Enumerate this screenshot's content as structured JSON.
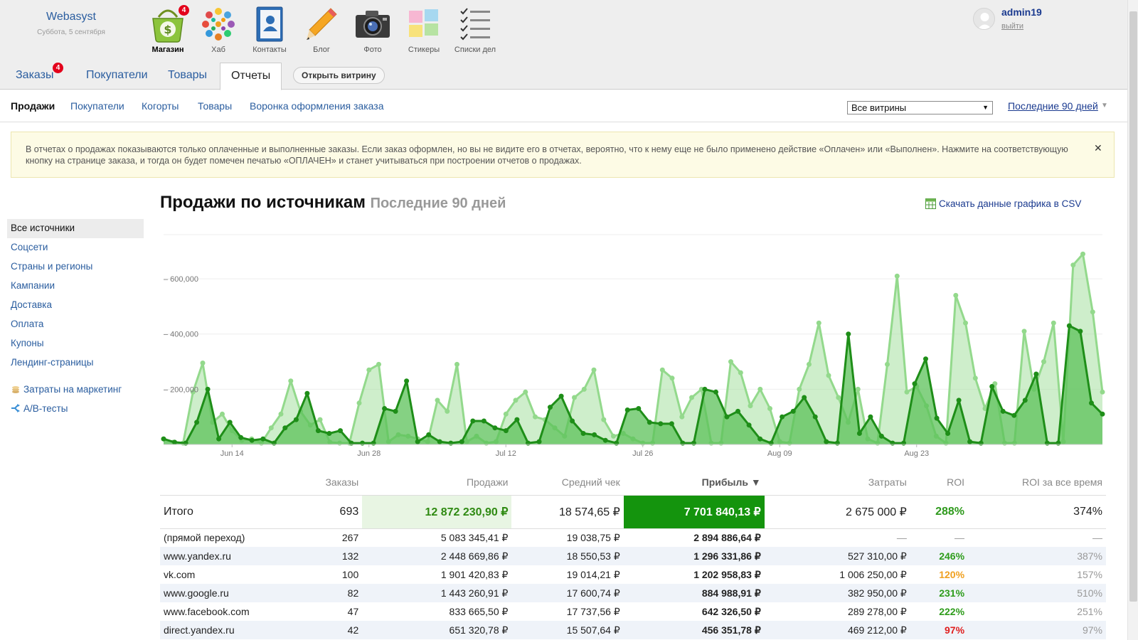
{
  "brand": {
    "name": "Webasyst",
    "date": "Суббота, 5 сентября"
  },
  "apps": [
    {
      "label": "Магазин",
      "icon": "shop-basket-icon",
      "badge": "4",
      "active": true
    },
    {
      "label": "Хаб",
      "icon": "hub-icon"
    },
    {
      "label": "Контакты",
      "icon": "contacts-icon"
    },
    {
      "label": "Блог",
      "icon": "blog-pencil-icon"
    },
    {
      "label": "Фото",
      "icon": "photo-camera-icon"
    },
    {
      "label": "Стикеры",
      "icon": "stickers-icon"
    },
    {
      "label": "Списки дел",
      "icon": "checklists-icon"
    }
  ],
  "user": {
    "name": "admin19",
    "logout": "выйти"
  },
  "tabs": {
    "orders": {
      "label": "Заказы",
      "badge": "4"
    },
    "customers": {
      "label": "Покупатели"
    },
    "products": {
      "label": "Товары"
    },
    "reports": {
      "label": "Отчеты"
    },
    "storefront": "Открыть витрину"
  },
  "subnav": {
    "sales": "Продажи",
    "customers": "Покупатели",
    "cohorts": "Когорты",
    "products": "Товары",
    "funnel": "Воронка оформления заказа",
    "storefront_select": "Все витрины",
    "period": "Последние 90 дней"
  },
  "notice": "В отчетах о продажах показываются только оплаченные и выполненные заказы. Если заказ оформлен, но вы не видите его в отчетах, вероятно, что к нему еще не было применено действие «Оплачен» или «Выполнен». Нажмите на соответствующую кнопку на странице заказа, и тогда он будет помечен печатью «ОПЛАЧЕН» и станет учитываться при построении отчетов о продажах.",
  "sidebar": {
    "items": [
      "Все источники",
      "Соцсети",
      "Страны и регионы",
      "Кампании",
      "Доставка",
      "Оплата",
      "Купоны",
      "Лендинг-страницы"
    ],
    "marketing": "Затраты на маркетинг",
    "abtests": "А/В-тесты"
  },
  "report": {
    "title": "Продажи по источникам",
    "period": "Последние 90 дней",
    "csv": "Скачать данные графика в CSV"
  },
  "chart_data": {
    "type": "area",
    "title": "",
    "xlabel": "",
    "ylabel": "",
    "ylim": [
      0,
      760000
    ],
    "yticks": [
      200000,
      400000,
      600000
    ],
    "ytick_labels": [
      "200,000",
      "400,000",
      "600,000"
    ],
    "xtick_labels": [
      "Jun 14",
      "Jun 28",
      "Jul 12",
      "Jul 26",
      "Aug 09",
      "Aug 23"
    ],
    "grid": true,
    "series": [
      {
        "values": [
          20000,
          8000,
          5000,
          190000,
          295000,
          80000,
          110000,
          50000,
          15000,
          20000,
          5000,
          60000,
          110000,
          230000,
          120000,
          70000,
          90000,
          8000,
          5000,
          5000,
          150000,
          270000,
          290000,
          10000,
          35000,
          30000,
          20000,
          10000,
          160000,
          120000,
          290000,
          10000,
          30000,
          5000,
          10000,
          110000,
          160000,
          190000,
          100000,
          90000,
          60000,
          30000,
          170000,
          200000,
          270000,
          90000,
          30000,
          40000,
          20000,
          5000,
          5000,
          270000,
          240000,
          100000,
          170000,
          200000,
          5000,
          5000,
          300000,
          260000,
          140000,
          200000,
          130000,
          10000,
          5000,
          200000,
          290000,
          440000,
          250000,
          170000,
          80000,
          200000,
          20000,
          5000,
          290000,
          610000,
          190000,
          210000,
          140000,
          30000,
          5000,
          540000,
          440000,
          240000,
          130000,
          220000,
          5000,
          5000,
          410000,
          200000,
          300000,
          440000,
          10000,
          650000,
          690000,
          480000,
          190000
        ]
      },
      {
        "values": [
          20000,
          8000,
          5000,
          80000,
          200000,
          20000,
          80000,
          25000,
          15000,
          20000,
          5000,
          60000,
          90000,
          185000,
          50000,
          40000,
          50000,
          5000,
          5000,
          5000,
          130000,
          120000,
          230000,
          10000,
          35000,
          10000,
          5000,
          10000,
          85000,
          85000,
          60000,
          50000,
          90000,
          5000,
          10000,
          135000,
          175000,
          85000,
          40000,
          35000,
          15000,
          5000,
          125000,
          130000,
          80000,
          75000,
          75000,
          5000,
          5000,
          200000,
          190000,
          100000,
          120000,
          70000,
          20000,
          5000,
          100000,
          120000,
          170000,
          100000,
          10000,
          5000,
          400000,
          40000,
          100000,
          30000,
          5000,
          5000,
          220000,
          310000,
          95000,
          40000,
          160000,
          10000,
          5000,
          210000,
          120000,
          105000,
          160000,
          255000,
          5000,
          5000,
          430000,
          410000,
          150000,
          110000
        ]
      }
    ]
  },
  "table": {
    "headers": {
      "orders": "Заказы",
      "sales": "Продажи",
      "avg": "Средний чек",
      "profit": "Прибыль ▼",
      "costs": "Затраты",
      "roi": "ROI",
      "roi_all": "ROI за все время"
    },
    "total": {
      "label": "Итого",
      "orders": "693",
      "sales": "12 872 230,90 ₽",
      "avg": "18 574,65 ₽",
      "profit": "7 701 840,13 ₽",
      "costs": "2 675 000 ₽",
      "roi": "288%",
      "roi_all": "374%"
    },
    "rows": [
      {
        "source": "(прямой переход)",
        "orders": "267",
        "sales": "5 083 345,41 ₽",
        "avg": "19 038,75 ₽",
        "profit": "2 894 886,64 ₽",
        "costs": "—",
        "roi": "—",
        "roi_all": "—",
        "roi_color": "muted"
      },
      {
        "source": "www.yandex.ru",
        "orders": "132",
        "sales": "2 448 669,86 ₽",
        "avg": "18 550,53 ₽",
        "profit": "1 296 331,86 ₽",
        "costs": "527 310,00 ₽",
        "roi": "246%",
        "roi_all": "387%",
        "roi_color": "green"
      },
      {
        "source": "vk.com",
        "orders": "100",
        "sales": "1 901 420,83 ₽",
        "avg": "19 014,21 ₽",
        "profit": "1 202 958,83 ₽",
        "costs": "1 006 250,00 ₽",
        "roi": "120%",
        "roi_all": "157%",
        "roi_color": "orange"
      },
      {
        "source": "www.google.ru",
        "orders": "82",
        "sales": "1 443 260,91 ₽",
        "avg": "17 600,74 ₽",
        "profit": "884 988,91 ₽",
        "costs": "382 950,00 ₽",
        "roi": "231%",
        "roi_all": "510%",
        "roi_color": "green"
      },
      {
        "source": "www.facebook.com",
        "orders": "47",
        "sales": "833 665,50 ₽",
        "avg": "17 737,56 ₽",
        "profit": "642 326,50 ₽",
        "costs": "289 278,00 ₽",
        "roi": "222%",
        "roi_all": "251%",
        "roi_color": "green"
      },
      {
        "source": "direct.yandex.ru",
        "orders": "42",
        "sales": "651 320,78 ₽",
        "avg": "15 507,64 ₽",
        "profit": "456 351,78 ₽",
        "costs": "469 212,00 ₽",
        "roi": "97%",
        "roi_all": "97%",
        "roi_color": "red"
      }
    ]
  },
  "colors": {
    "light_series": "#a6e0a0",
    "dark_series": "#1e8e18",
    "link": "#2a5d9f",
    "profit_bg": "#14940d"
  }
}
